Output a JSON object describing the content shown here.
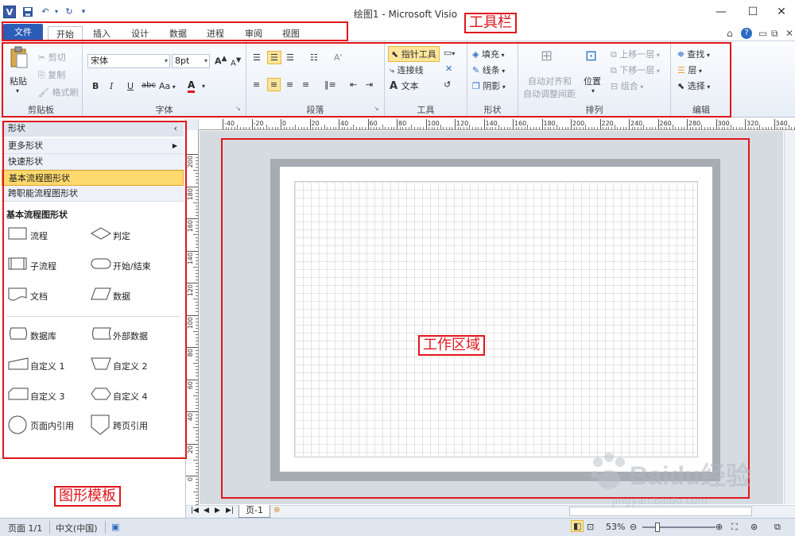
{
  "window": {
    "title": "绘图1 - Microsoft Visio",
    "logo": "V"
  },
  "tabs": [
    "文件",
    "开始",
    "插入",
    "设计",
    "数据",
    "进程",
    "审阅",
    "视图"
  ],
  "ribbon": {
    "clipboard": {
      "label": "剪贴板",
      "paste": "粘贴",
      "cut": "剪切",
      "copy": "复制",
      "format_painter": "格式刷"
    },
    "font": {
      "label": "字体",
      "font_name": "宋体",
      "font_size": "8pt",
      "bold": "B",
      "italic": "I",
      "underline": "U",
      "strike": "abc",
      "case": "Aa",
      "color": "A"
    },
    "paragraph": {
      "label": "段落"
    },
    "tools": {
      "label": "工具",
      "pointer": "指针工具",
      "connector": "连接线",
      "text": "文本"
    },
    "shape": {
      "label": "形状",
      "fill": "填充",
      "line": "线条",
      "shadow": "阴影"
    },
    "arrange": {
      "label": "排列",
      "auto_align_1": "自动对齐和",
      "auto_align_2": "自动调整间距",
      "position": "位置",
      "bring_forward": "上移一层",
      "send_backward": "下移一层",
      "group": "组合"
    },
    "editing": {
      "label": "编辑",
      "find": "查找",
      "layers": "层",
      "select": "选择"
    }
  },
  "panel": {
    "header": "形状",
    "more_shapes": "更多形状",
    "quick_shapes": "快速形状",
    "basic_flowchart": "基本流程图形状",
    "cross_functional": "跨职能流程图形状",
    "stencil_title": "基本流程图形状",
    "shapes": [
      {
        "label": "流程",
        "icon": "process-shape-icon"
      },
      {
        "label": "判定",
        "icon": "decision-shape-icon"
      },
      {
        "label": "子流程",
        "icon": "subprocess-shape-icon"
      },
      {
        "label": "开始/结束",
        "icon": "start-end-shape-icon"
      },
      {
        "label": "文档",
        "icon": "document-shape-icon"
      },
      {
        "label": "数据",
        "icon": "data-shape-icon"
      },
      {
        "label": "数据库",
        "icon": "database-shape-icon"
      },
      {
        "label": "外部数据",
        "icon": "external-data-shape-icon"
      },
      {
        "label": "自定义 1",
        "icon": "custom1-shape-icon"
      },
      {
        "label": "自定义 2",
        "icon": "custom2-shape-icon"
      },
      {
        "label": "自定义 3",
        "icon": "custom3-shape-icon"
      },
      {
        "label": "自定义 4",
        "icon": "custom4-shape-icon"
      },
      {
        "label": "页面内引用",
        "icon": "on-page-ref-shape-icon"
      },
      {
        "label": "跨页引用",
        "icon": "off-page-ref-shape-icon"
      }
    ]
  },
  "ruler": {
    "h_ticks": [
      "-40",
      "-20",
      "0",
      "20",
      "40",
      "60",
      "80",
      "100",
      "120",
      "140",
      "160",
      "180",
      "200",
      "220",
      "240",
      "260",
      "280",
      "300",
      "320",
      "340"
    ],
    "v_ticks": [
      "200",
      "180",
      "160",
      "140",
      "120",
      "100",
      "80",
      "60",
      "40",
      "20",
      "0"
    ]
  },
  "page_tabs": {
    "page1": "页-1"
  },
  "status": {
    "page": "页面 1/1",
    "language": "中文(中国)",
    "zoom": "53%"
  },
  "annotations": {
    "toolbar": "工具栏",
    "shapes_stencil": "图形模板",
    "work_area": "工作区域"
  },
  "watermark": {
    "brand": "Baidu经验",
    "url": "jingyan.baidu.com"
  },
  "colors": {
    "file_tab": "#2b5cb8",
    "accent_red": "#e0161b",
    "highlight": "#fdd86c"
  }
}
